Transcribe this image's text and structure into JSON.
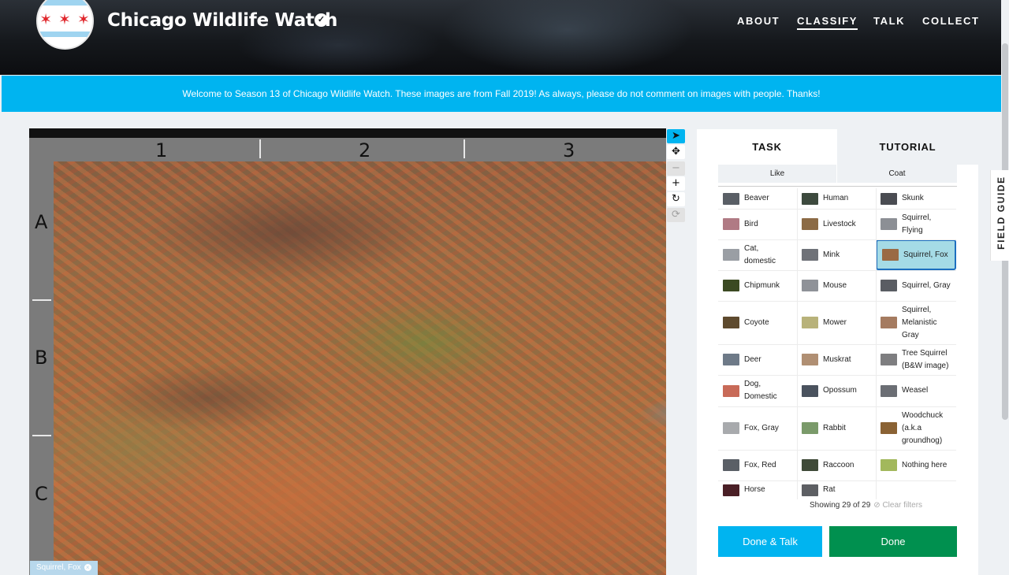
{
  "header": {
    "title": "Chicago Wildlife Watch",
    "nav": [
      "ABOUT",
      "CLASSIFY",
      "TALK",
      "COLLECT"
    ],
    "active_nav": "CLASSIFY"
  },
  "banner": {
    "text": "Welcome to Season 13 of Chicago Wildlife Watch. These images are from Fall 2019! As always, please do not comment on images with people. Thanks!"
  },
  "viewer": {
    "columns": [
      "1",
      "2",
      "3"
    ],
    "rows": [
      "A",
      "B",
      "C"
    ],
    "selected_tag": "Squirrel, Fox"
  },
  "panel": {
    "tabs": [
      "TASK",
      "TUTORIAL"
    ],
    "active_tab": "TASK",
    "filters": [
      "Like",
      "Coat"
    ],
    "species": [
      [
        "Beaver",
        "Human",
        "Skunk"
      ],
      [
        "Bird",
        "Livestock",
        "Squirrel, Flying"
      ],
      [
        "Cat, domestic",
        "Mink",
        "Squirrel, Fox"
      ],
      [
        "Chipmunk",
        "Mouse",
        "Squirrel, Gray"
      ],
      [
        "Coyote",
        "Mower",
        "Squirrel, Melanistic Gray"
      ],
      [
        "Deer",
        "Muskrat",
        "Tree Squirrel (B&W image)"
      ],
      [
        "Dog, Domestic",
        "Opossum",
        "Weasel"
      ],
      [
        "Fox, Gray",
        "Rabbit",
        "Woodchuck (a.k.a groundhog)"
      ],
      [
        "Fox, Red",
        "Raccoon",
        "Nothing here"
      ],
      [
        "Horse",
        "Rat"
      ]
    ],
    "selected_species": "Squirrel, Fox",
    "showing": "Showing 29 of 29",
    "clear_filters": "Clear filters",
    "done_talk": "Done & Talk",
    "done": "Done"
  },
  "field_guide": "FIELD GUIDE",
  "colors": {
    "accent": "#00b4f0",
    "done_green": "#00904f",
    "selected_cell": "#a5dbe6"
  }
}
